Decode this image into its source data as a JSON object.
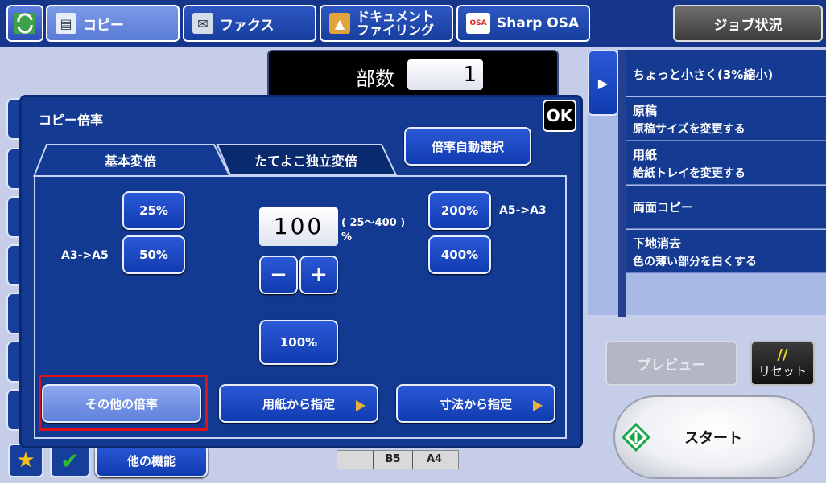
{
  "top_tabs": [
    {
      "label": "コピー"
    },
    {
      "label": "ファクス"
    },
    {
      "label": "ドキュメント\nファイリング"
    },
    {
      "label": "Sharp OSA"
    }
  ],
  "job_status_label": "ジョブ状況",
  "copies": {
    "label": "部数",
    "value": "1"
  },
  "dialog": {
    "title": "コピー倍率",
    "ok_label": "OK",
    "tab_basic": "基本変倍",
    "tab_xy": "たてよこ独立変倍",
    "auto_select_label": "倍率自動選択",
    "preset_25": "25%",
    "preset_50": "50%",
    "label_a3_a5": "A3->A5",
    "zoom_value": "100",
    "zoom_range": "( 25～400 )",
    "zoom_unit": "%",
    "minus": "−",
    "plus": "+",
    "preset_200": "200%",
    "label_a5_a3": "A5->A3",
    "preset_400": "400%",
    "preset_100": "100%",
    "other_ratio_label": "その他の倍率",
    "from_paper_label": "用紙から指定",
    "from_size_label": "寸法から指定"
  },
  "right_menu": [
    {
      "title": "ちょっと小さく(3%縮小)",
      "sub": ""
    },
    {
      "title": "原稿",
      "sub": "原稿サイズを変更する"
    },
    {
      "title": "用紙",
      "sub": "給紙トレイを変更する"
    },
    {
      "title": "両面コピー",
      "sub": ""
    },
    {
      "title": "下地消去",
      "sub": "色の薄い部分を白くする"
    }
  ],
  "preview_label": "プレビュー",
  "reset": {
    "symbol": "//",
    "label": "リセット"
  },
  "start_label": "スタート",
  "bottom": {
    "other_functions_label": "他の機能"
  },
  "paper_trays": [
    "B5",
    "A4"
  ],
  "colors": {
    "accent_red": "#e0101c",
    "panel_blue": "#143a92",
    "start_green": "#18a84a"
  }
}
